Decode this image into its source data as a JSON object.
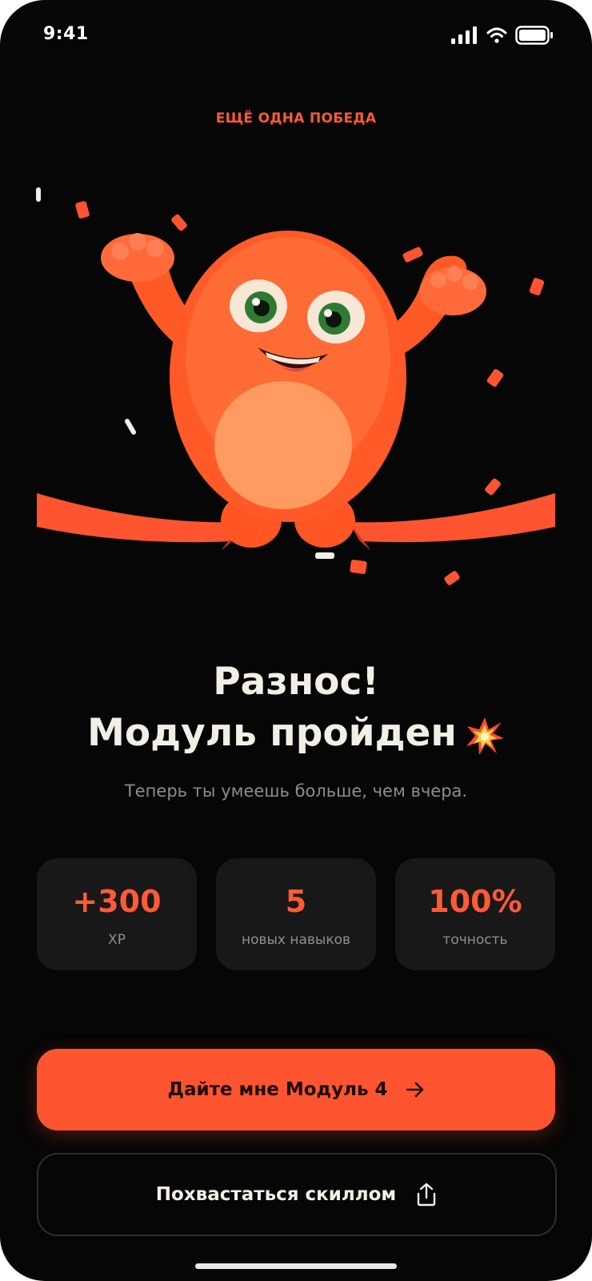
{
  "status_bar": {
    "time": "9:41"
  },
  "kicker": "ЕЩЁ ОДНА ПОБЕДА",
  "hero": {
    "image": "celebrating-orange-monster"
  },
  "headline": {
    "line1": "Разнос!",
    "line2": "Модуль пройден"
  },
  "subtitle": "Теперь ты умеешь больше, чем вчера.",
  "stats": [
    {
      "value": "+300",
      "label": "XP"
    },
    {
      "value": "5",
      "label": "новых навыков"
    },
    {
      "value": "100%",
      "label": "точность"
    }
  ],
  "primary_button": {
    "label": "Дайте мне Модуль 4",
    "icon": "arrow-right-icon"
  },
  "secondary_button": {
    "label": "Похвастаться скиллом",
    "icon": "share-icon"
  },
  "colors": {
    "accent": "#ff5430",
    "background": "#060606",
    "card": "#181818",
    "text": "#f1efe6"
  }
}
